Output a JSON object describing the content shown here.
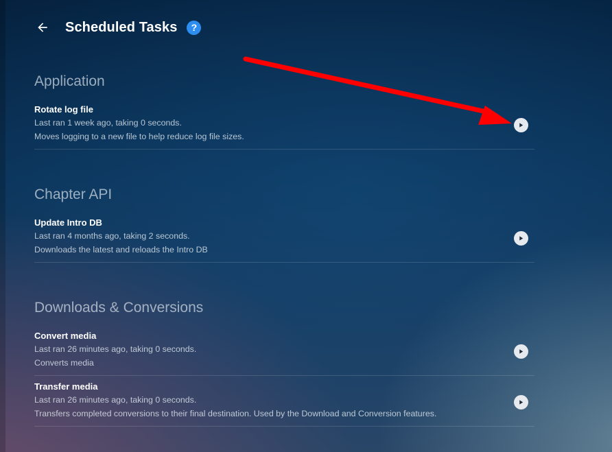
{
  "header": {
    "title": "Scheduled Tasks",
    "help_label": "?"
  },
  "sections": [
    {
      "title": "Application",
      "tasks": [
        {
          "name": "Rotate log file",
          "last_run": "Last ran 1 week ago, taking 0 seconds.",
          "description": "Moves logging to a new file to help reduce log file sizes."
        }
      ]
    },
    {
      "title": "Chapter API",
      "tasks": [
        {
          "name": "Update Intro DB",
          "last_run": "Last ran 4 months ago, taking 2 seconds.",
          "description": "Downloads the latest and reloads the Intro DB"
        }
      ]
    },
    {
      "title": "Downloads & Conversions",
      "tasks": [
        {
          "name": "Convert media",
          "last_run": "Last ran 26 minutes ago, taking 0 seconds.",
          "description": "Converts media"
        },
        {
          "name": "Transfer media",
          "last_run": "Last ran 26 minutes ago, taking 0 seconds.",
          "description": "Transfers completed conversions to their final destination. Used by the Download and Conversion features."
        }
      ]
    }
  ],
  "icons": {
    "back": "arrow-left-icon",
    "help": "question-circle-icon",
    "run": "play-icon",
    "annotation": "red-arrow-annotation"
  },
  "colors": {
    "accent": "#2e8ef0",
    "annotation": "#ff0000",
    "run_button": "#e6e9ee"
  }
}
